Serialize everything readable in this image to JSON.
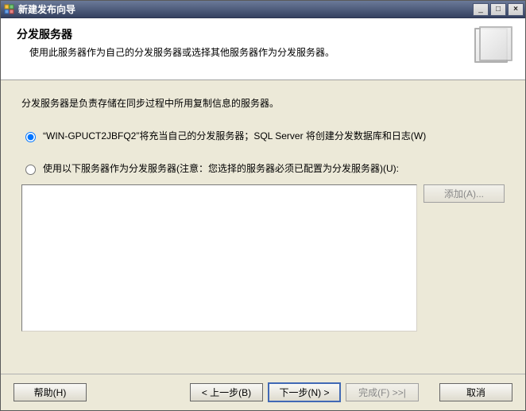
{
  "window": {
    "title": "新建发布向导"
  },
  "header": {
    "title": "分发服务器",
    "subtitle": "使用此服务器作为自己的分发服务器或选择其他服务器作为分发服务器。"
  },
  "content": {
    "description": "分发服务器是负责存储在同步过程中所用复制信息的服务器。",
    "option_self_prefix": "“WIN-GPUCT2JBFQ2”将充当自己的分发服务器；SQL Server 将创建分发数据库和日志(W)",
    "option_other": "使用以下服务器作为分发服务器(注意：您选择的服务器必须已配置为分发服务器)(U):",
    "add_button": "添加(A)..."
  },
  "footer": {
    "help": "帮助(H)",
    "back": "< 上一步(B)",
    "next": "下一步(N) >",
    "finish": "完成(F) >>|",
    "cancel": "取消"
  },
  "win_controls": {
    "minimize": "_",
    "maximize": "□",
    "close": "×"
  }
}
